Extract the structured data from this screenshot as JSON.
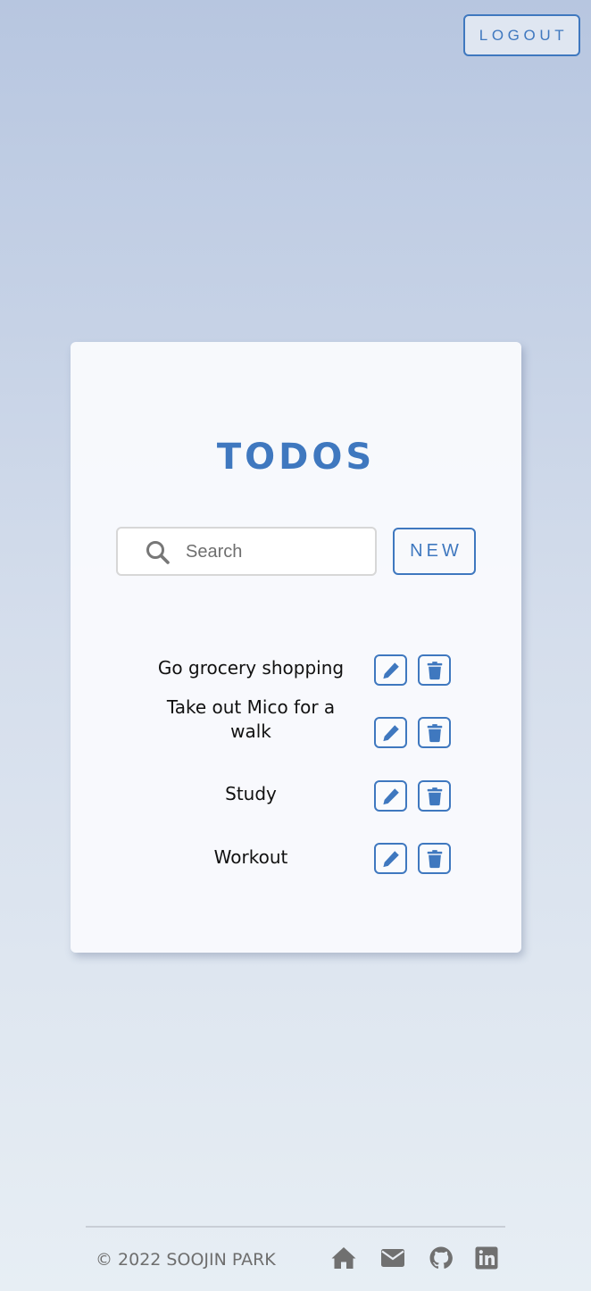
{
  "header": {
    "logout_label": "LOGOUT"
  },
  "card": {
    "title": "TODOS",
    "search": {
      "placeholder": "Search",
      "value": ""
    },
    "new_label": "NEW",
    "todos": [
      {
        "text": "Go grocery shopping"
      },
      {
        "text": "Take out Mico for a walk"
      },
      {
        "text": "Study"
      },
      {
        "text": "Workout"
      }
    ]
  },
  "footer": {
    "copyright": "© 2022 SOOJIN PARK",
    "icons": [
      "home-icon",
      "envelope-icon",
      "github-icon",
      "linkedin-icon"
    ]
  },
  "colors": {
    "accent": "#3f78bf",
    "footer_gray": "#6e6e6e"
  }
}
